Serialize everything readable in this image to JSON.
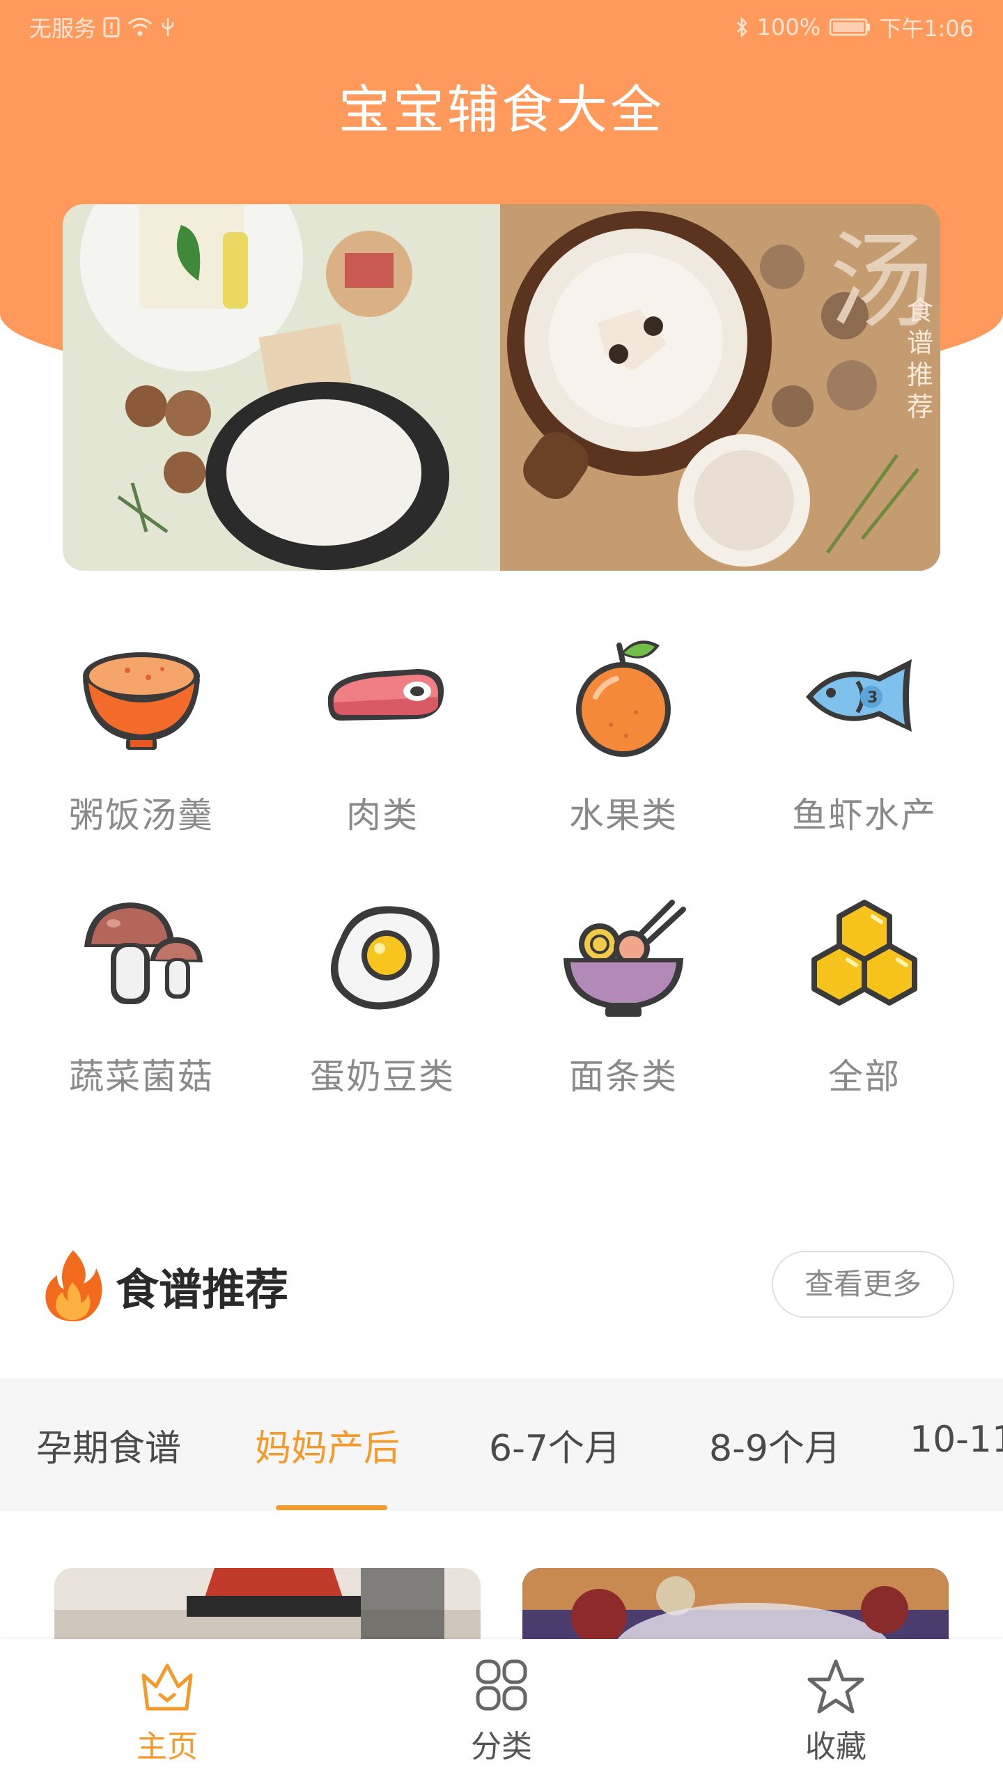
{
  "status_bar": {
    "carrier": "无服务",
    "battery": "100%",
    "time": "下午1:06"
  },
  "app": {
    "title": "宝宝辅食大全"
  },
  "banner": {
    "vertical_text": "食谱推荐",
    "big_char": "汤"
  },
  "categories": [
    {
      "label": "粥饭汤羹",
      "icon": "porridge-bowl-icon"
    },
    {
      "label": "肉类",
      "icon": "meat-icon"
    },
    {
      "label": "水果类",
      "icon": "orange-fruit-icon"
    },
    {
      "label": "鱼虾水产",
      "icon": "fish-icon"
    },
    {
      "label": "蔬菜菌菇",
      "icon": "mushroom-icon"
    },
    {
      "label": "蛋奶豆类",
      "icon": "fried-egg-icon"
    },
    {
      "label": "面条类",
      "icon": "noodle-bowl-icon"
    },
    {
      "label": "全部",
      "icon": "honeycomb-icon"
    }
  ],
  "recommend": {
    "title": "食谱推荐",
    "more_label": "查看更多",
    "tabs": [
      {
        "label": "孕期食谱",
        "active": false
      },
      {
        "label": "妈妈产后",
        "active": true
      },
      {
        "label": "6-7个月",
        "active": false
      },
      {
        "label": "8-9个月",
        "active": false
      },
      {
        "label": "10-11",
        "active": false
      }
    ]
  },
  "bottom_nav": [
    {
      "label": "主页",
      "icon": "crown-icon",
      "active": true
    },
    {
      "label": "分类",
      "icon": "grid-icon",
      "active": false
    },
    {
      "label": "收藏",
      "icon": "star-icon",
      "active": false
    }
  ],
  "colors": {
    "header": "#FF9A5C",
    "accent": "#F39A2C",
    "text_gray": "#8A8A8A"
  }
}
